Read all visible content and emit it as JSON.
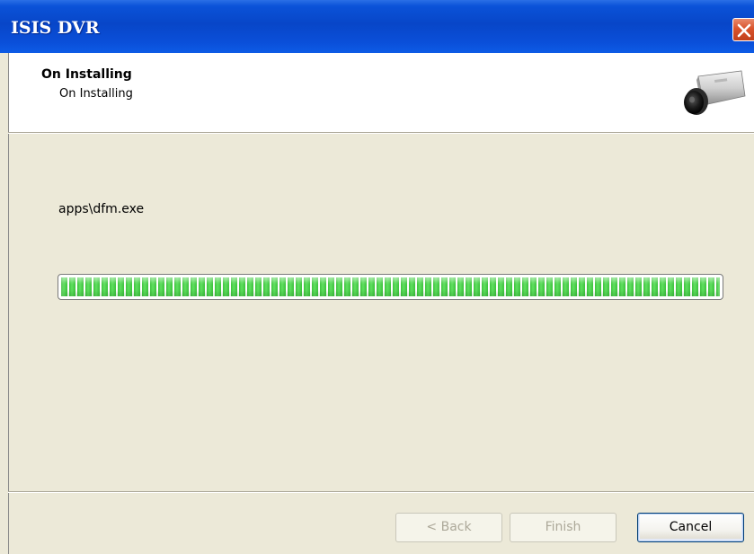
{
  "window": {
    "title": "ISIS DVR"
  },
  "header": {
    "title": "On Installing",
    "subtitle": "On Installing"
  },
  "content": {
    "current_file": "apps\\dfm.exe",
    "progress_fraction": 1.0
  },
  "buttons": {
    "back_label": "< Back",
    "finish_label": "Finish",
    "cancel_label": "Cancel"
  },
  "icons": {
    "close": "close-icon",
    "camera": "camera-icon"
  },
  "colors": {
    "titlebar": "#0846c8",
    "progress_green": "#3ec13e",
    "close_red": "#d9532c",
    "dialog_bg": "#ece9d8"
  }
}
